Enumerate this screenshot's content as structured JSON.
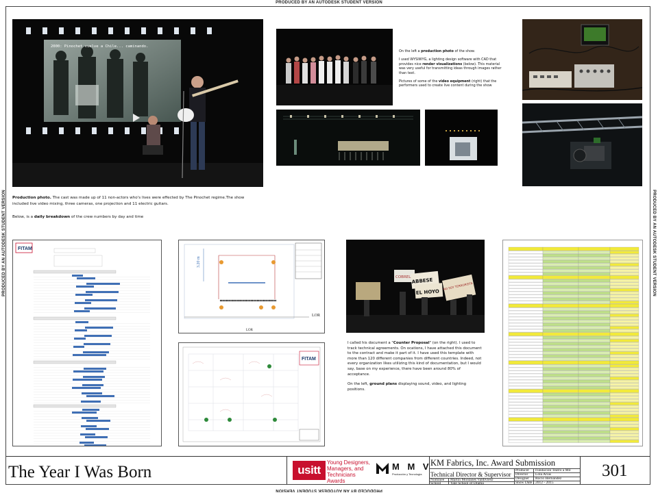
{
  "watermark": "PRODUCED BY AN AUTODESK STUDENT VERSION",
  "production_photo": {
    "projection_caption": "2000: Pinochet vuelve a Chile... caminando."
  },
  "captions": {
    "production_label": "Production photo.",
    "production_text": " The cast was made up of 11 non-actors who's lives were effected by The Pinochet regime.The show included live video mixing, three cameras, one projection and 11 electric guitars.",
    "breakdown_prefix": "Below, is a ",
    "breakdown_bold": "daily breakdown",
    "breakdown_suffix": " of the crew numbers by day and time",
    "side_p1_prefix": "On the left a ",
    "side_p1_bold": "production photo",
    "side_p1_suffix": " of the show.",
    "side_p2_prefix": "I used WYSIWYG, a lighting design software with CAD that provides nice ",
    "side_p2_bold": "render visualizations",
    "side_p2_suffix": " (below). This material was very useful for transmitting ideas through images rather than text.",
    "side_p3_prefix": "Pictures of some of the ",
    "side_p3_bold": "video equipment",
    "side_p3_suffix": " (right) that the performers used to create live content during the show",
    "counter_p1_prefix": "I called his document a \"",
    "counter_p1_bold": "Counter Proposal",
    "counter_p1_suffix": "\" (on the right). I used to track technical agreements. On ocations, I have attached this document to the contract and make it part of it. I have used this template with more than 120 different companies from different countries. Indeed, not every organization likes utilizing this kind of documentation, but I would say, base on my experience, there have been around 80% of acceptance.",
    "counter_p2_prefix": "On the left, ",
    "counter_p2_bold": "ground plans",
    "counter_p2_suffix": " displaying sound, video, and lighting positions."
  },
  "ground_plan": {
    "label_lor": "LOR",
    "dim_label": "3.20 m"
  },
  "protest_signs": [
    "ABBESE",
    "EL HOYO",
    "NO SOY TERRORISTA",
    "COBRELE"
  ],
  "title_block": {
    "show_title": "The Year I Was Born",
    "usitt": "usitt",
    "program": "Young Designers, Managers, and Technicians Awards",
    "mmv_letters": "M M V",
    "mmv_sub": "Producción y Tecnología",
    "award": "KM Fabrics, Inc. Award Submission",
    "role": "Technical Director & Supervisor",
    "nominee_label": "Nominee",
    "nominee": "Martín Montanes Valdivieso",
    "school_label": "School",
    "school": "Yale School of Drama",
    "producer_label": "Producer",
    "producer": "Fundación Teatro a Mil",
    "director_label": "Director",
    "director": "Lola Arias",
    "designer_label": "Designer",
    "designer": "Rocío Hernández",
    "show_date_label": "Show Date",
    "show_date": "2012 - 2015",
    "plate": "301"
  },
  "colors": {
    "usitt_red": "#c8102e",
    "schedule_blue": "#3f6fb5",
    "counter_yellow": "#f2ea3a",
    "counter_green": "#bfe08a"
  }
}
